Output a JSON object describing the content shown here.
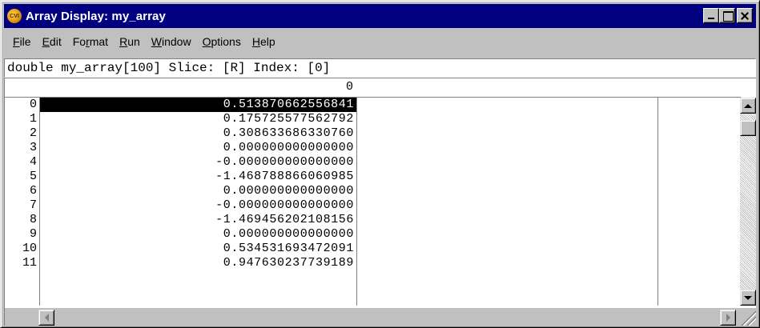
{
  "window": {
    "title": "Array Display: my_array",
    "icon": "cvi-app-icon",
    "icon_text": "CVI",
    "title_bar_color": "#000080"
  },
  "menu": [
    {
      "name": "file",
      "before": "",
      "underlined": "F",
      "after": "ile"
    },
    {
      "name": "edit",
      "before": "",
      "underlined": "E",
      "after": "dit"
    },
    {
      "name": "format",
      "before": "Fo",
      "underlined": "r",
      "after": "mat"
    },
    {
      "name": "run",
      "before": "",
      "underlined": "R",
      "after": "un"
    },
    {
      "name": "window",
      "before": "",
      "underlined": "W",
      "after": "indow"
    },
    {
      "name": "options",
      "before": "",
      "underlined": "O",
      "after": "ptions"
    },
    {
      "name": "help",
      "before": "",
      "underlined": "H",
      "after": "elp"
    }
  ],
  "info_line": "double my_array[100] Slice: [R] Index: [0]",
  "grid": {
    "column_header": "0",
    "selected_row": 0,
    "rows": [
      {
        "index": "0",
        "value": "0.513870662556841"
      },
      {
        "index": "1",
        "value": "0.175725577562792"
      },
      {
        "index": "2",
        "value": "0.308633686330760"
      },
      {
        "index": "3",
        "value": "0.000000000000000"
      },
      {
        "index": "4",
        "value": "-0.000000000000000"
      },
      {
        "index": "5",
        "value": "-1.468788866060985"
      },
      {
        "index": "6",
        "value": "0.000000000000000"
      },
      {
        "index": "7",
        "value": "-0.000000000000000"
      },
      {
        "index": "8",
        "value": "-1.469456202108156"
      },
      {
        "index": "9",
        "value": "0.000000000000000"
      },
      {
        "index": "10",
        "value": "0.534531693472091"
      },
      {
        "index": "11",
        "value": "0.947630237739189"
      }
    ]
  }
}
